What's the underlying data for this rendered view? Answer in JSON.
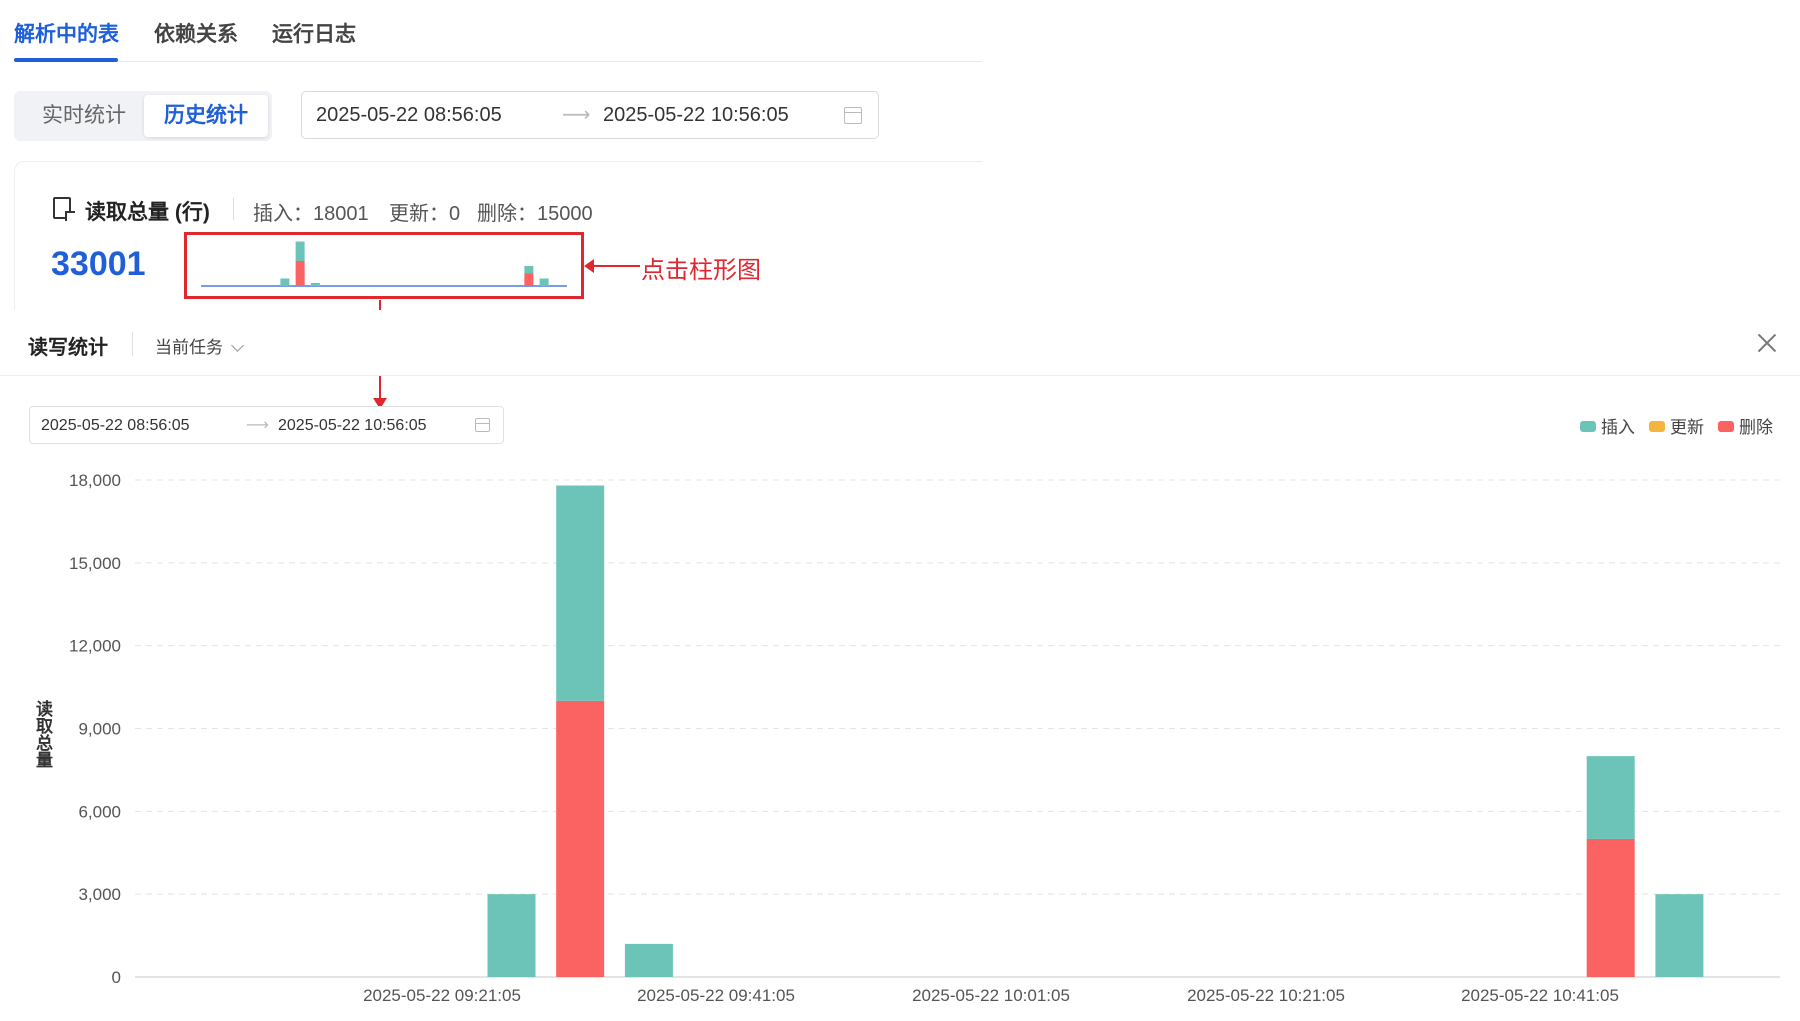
{
  "tabs": [
    {
      "label": "解析中的表",
      "active": true
    },
    {
      "label": "依赖关系",
      "active": false
    },
    {
      "label": "运行日志",
      "active": false
    }
  ],
  "segmented": {
    "realtime": "实时统计",
    "history": "历史统计",
    "selected": "历史统计"
  },
  "top_range": {
    "start": "2025-05-22 08:56:05",
    "end": "2025-05-22 10:56:05"
  },
  "card": {
    "title": "读取总量 (行)",
    "insert_label": "插入：",
    "insert_value": "18001",
    "update_label": "更新：",
    "update_value": "0",
    "delete_label": "删除：",
    "delete_value": "15000",
    "total": "33001"
  },
  "annotation": {
    "text": "点击柱形图"
  },
  "panel": {
    "title": "读写统计",
    "task_select": "当前任务",
    "range": {
      "start": "2025-05-22 08:56:05",
      "end": "2025-05-22 10:56:05"
    }
  },
  "legend": [
    {
      "name": "插入",
      "color": "#6cc4b8"
    },
    {
      "name": "更新",
      "color": "#f5b53c"
    },
    {
      "name": "删除",
      "color": "#fb6262"
    }
  ],
  "chart_data": {
    "type": "bar",
    "stacked": true,
    "ylabel": "读取总量",
    "ylim": [
      0,
      18000
    ],
    "yticks": [
      "18,000",
      "15,000",
      "12,000",
      "9,000",
      "6,000",
      "3,000",
      "0"
    ],
    "xticks": [
      "2025-05-22 09:21:05",
      "2025-05-22 09:41:05",
      "2025-05-22 10:01:05",
      "2025-05-22 10:21:05",
      "2025-05-22 10:41:05"
    ],
    "bars": [
      {
        "slot": 5,
        "insert": 3000,
        "update": 0,
        "delete": 0
      },
      {
        "slot": 6,
        "insert": 7800,
        "update": 0,
        "delete": 10000
      },
      {
        "slot": 7,
        "insert": 1200,
        "update": 0,
        "delete": 0
      },
      {
        "slot": 21,
        "insert": 3000,
        "update": 0,
        "delete": 5000
      },
      {
        "slot": 22,
        "insert": 3000,
        "update": 0,
        "delete": 0
      }
    ],
    "grid": true,
    "legend_position": "top-right"
  }
}
